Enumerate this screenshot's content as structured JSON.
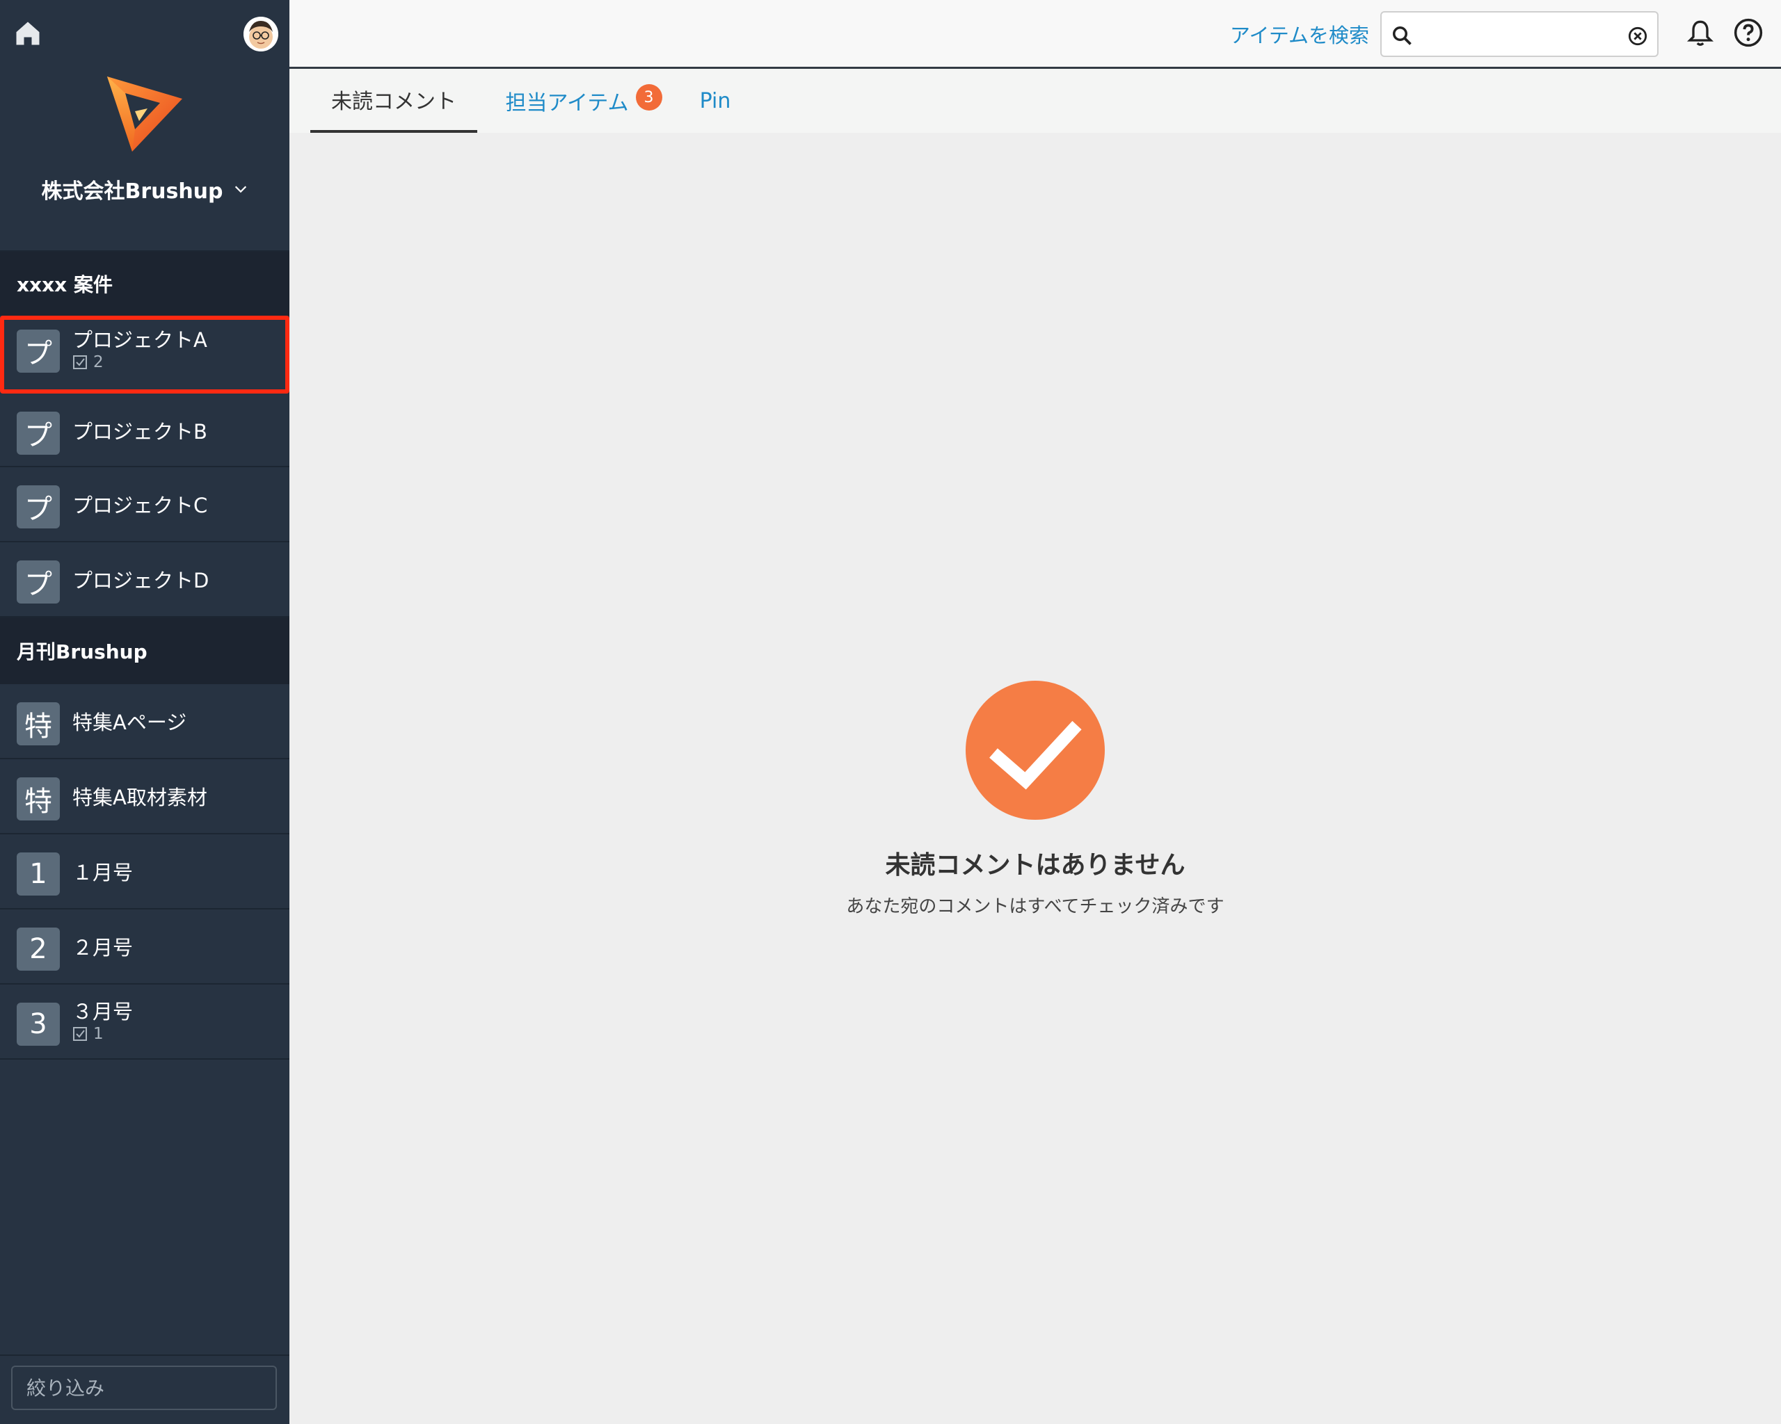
{
  "sidebar": {
    "org_name": "株式会社Brushup",
    "sections": [
      {
        "title": "xxxx 案件",
        "items": [
          {
            "tile": "プ",
            "name": "プロジェクトA",
            "count": "2"
          },
          {
            "tile": "プ",
            "name": "プロジェクトB"
          },
          {
            "tile": "プ",
            "name": "プロジェクトC"
          },
          {
            "tile": "プ",
            "name": "プロジェクトD"
          }
        ]
      },
      {
        "title": "月刊Brushup",
        "items": [
          {
            "tile": "特",
            "name": "特集Aページ"
          },
          {
            "tile": "特",
            "name": "特集A取材素材"
          },
          {
            "tile": "1",
            "name": "１月号"
          },
          {
            "tile": "2",
            "name": "２月号"
          },
          {
            "tile": "3",
            "name": "３月号",
            "count": "1"
          }
        ]
      }
    ],
    "filter_placeholder": "絞り込み"
  },
  "header": {
    "search_link": "アイテムを検索",
    "search_value": ""
  },
  "tabs": [
    {
      "label": "未読コメント"
    },
    {
      "label": "担当アイテム",
      "badge": "3"
    },
    {
      "label": "Pin"
    }
  ],
  "empty_state": {
    "title": "未読コメントはありません",
    "description": "あなた宛のコメントはすべてチェック済みです"
  },
  "colors": {
    "sidebar_bg": "#273342",
    "accent": "#f26b38",
    "link": "#1f8bc8",
    "highlight": "#ff2a12"
  }
}
